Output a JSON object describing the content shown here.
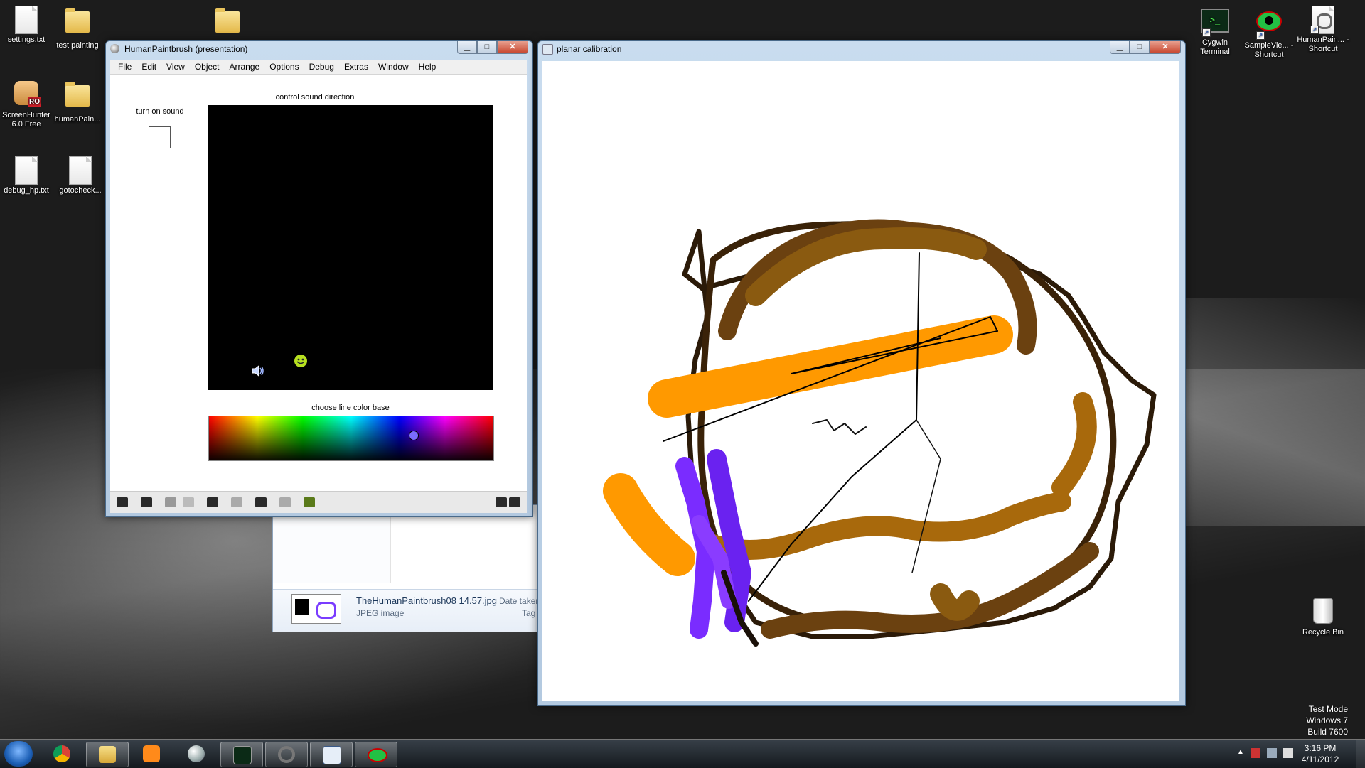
{
  "desktop": {
    "icons": [
      {
        "label": "settings.txt"
      },
      {
        "label": "test painting"
      },
      {
        "label": "ScreenHunter 6.0 Free"
      },
      {
        "label": "humanPain..."
      },
      {
        "label": "debug_hp.txt"
      },
      {
        "label": "gotocheck..."
      },
      {
        "label": "Cygwin Terminal"
      },
      {
        "label": "SampleVie... - Shortcut"
      },
      {
        "label": "HumanPain... - Shortcut"
      },
      {
        "label": "Recycle Bin"
      }
    ],
    "watermark": [
      "Test Mode",
      "Windows 7",
      "Build 7600"
    ]
  },
  "paint_window": {
    "title": "HumanPaintbrush (presentation)",
    "menu": [
      "File",
      "Edit",
      "View",
      "Object",
      "Arrange",
      "Options",
      "Debug",
      "Extras",
      "Window",
      "Help"
    ],
    "sound_label": "turn on sound",
    "sound_checked": false,
    "direction_label": "control sound direction",
    "color_label": "choose line color base",
    "color_hue": 0.72
  },
  "explorer": {
    "filename": "TheHumanPaintbrush08 14.57.jpg",
    "filetype": "JPEG image",
    "date_label": "Date taken",
    "tags_label": "Tag"
  },
  "canvas_window": {
    "title": "planar calibration",
    "colors": {
      "dark": "#2b1a08",
      "brown": "#8a5a10",
      "orange": "#ff9900",
      "purple": "#7a2cff"
    }
  },
  "taskbar": {
    "time": "3:16 PM",
    "date": "4/11/2012"
  }
}
